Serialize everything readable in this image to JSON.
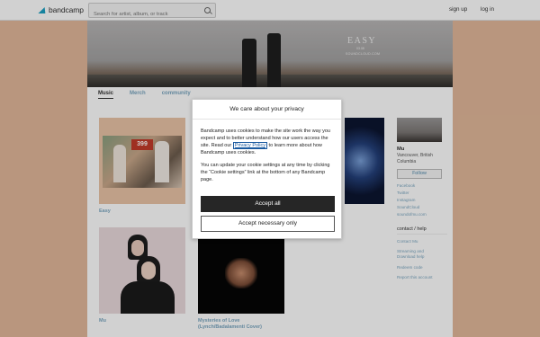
{
  "topbar": {
    "logo_text": "bandcamp",
    "search_placeholder": "Search for artist, album, or track",
    "signup": "sign up",
    "login": "log in"
  },
  "banner": {
    "title": "EASY",
    "sub": "03.08",
    "sub2": "SOUNDCLOUD.COM"
  },
  "tabs": [
    {
      "label": "Music",
      "active": true
    },
    {
      "label": "Merch",
      "active": false
    },
    {
      "label": "community",
      "active": false
    }
  ],
  "albums": [
    {
      "title": "Easy"
    },
    {
      "title": "Mu"
    },
    {
      "title": "Mysteries of Love\n(Lynch/Badalamenti Cover)"
    }
  ],
  "album_photo_text": "399",
  "sidebar": {
    "artist_name": "Mu",
    "location": "Vancouver, British Columbia",
    "follow": "Follow",
    "links": [
      "Facebook",
      "Twitter",
      "Instagram",
      "SoundCloud",
      "soundofmu.com"
    ],
    "contact_heading": "contact / help",
    "contact_links": [
      "Contact Mu",
      "Streaming and\nDownload help",
      "Redeem code",
      "Report this account"
    ]
  },
  "cookie_dialog": {
    "title": "We care about your privacy",
    "para1_before": "Bandcamp uses cookies to make the site work the way you expect and to better understand how our users access the site. Read our ",
    "privacy_link": "Privacy Policy",
    "para1_after": " to learn more about how Bandcamp uses cookies.",
    "para2": "You can update your cookie settings at any time by clicking the “Cookie settings” link at the bottom of any Bandcamp page.",
    "accept_all": "Accept all",
    "accept_necessary": "Accept necessary only"
  },
  "colors": {
    "background": "#e2b89a",
    "link": "#7aa6c0",
    "accept_button": "#262626"
  }
}
